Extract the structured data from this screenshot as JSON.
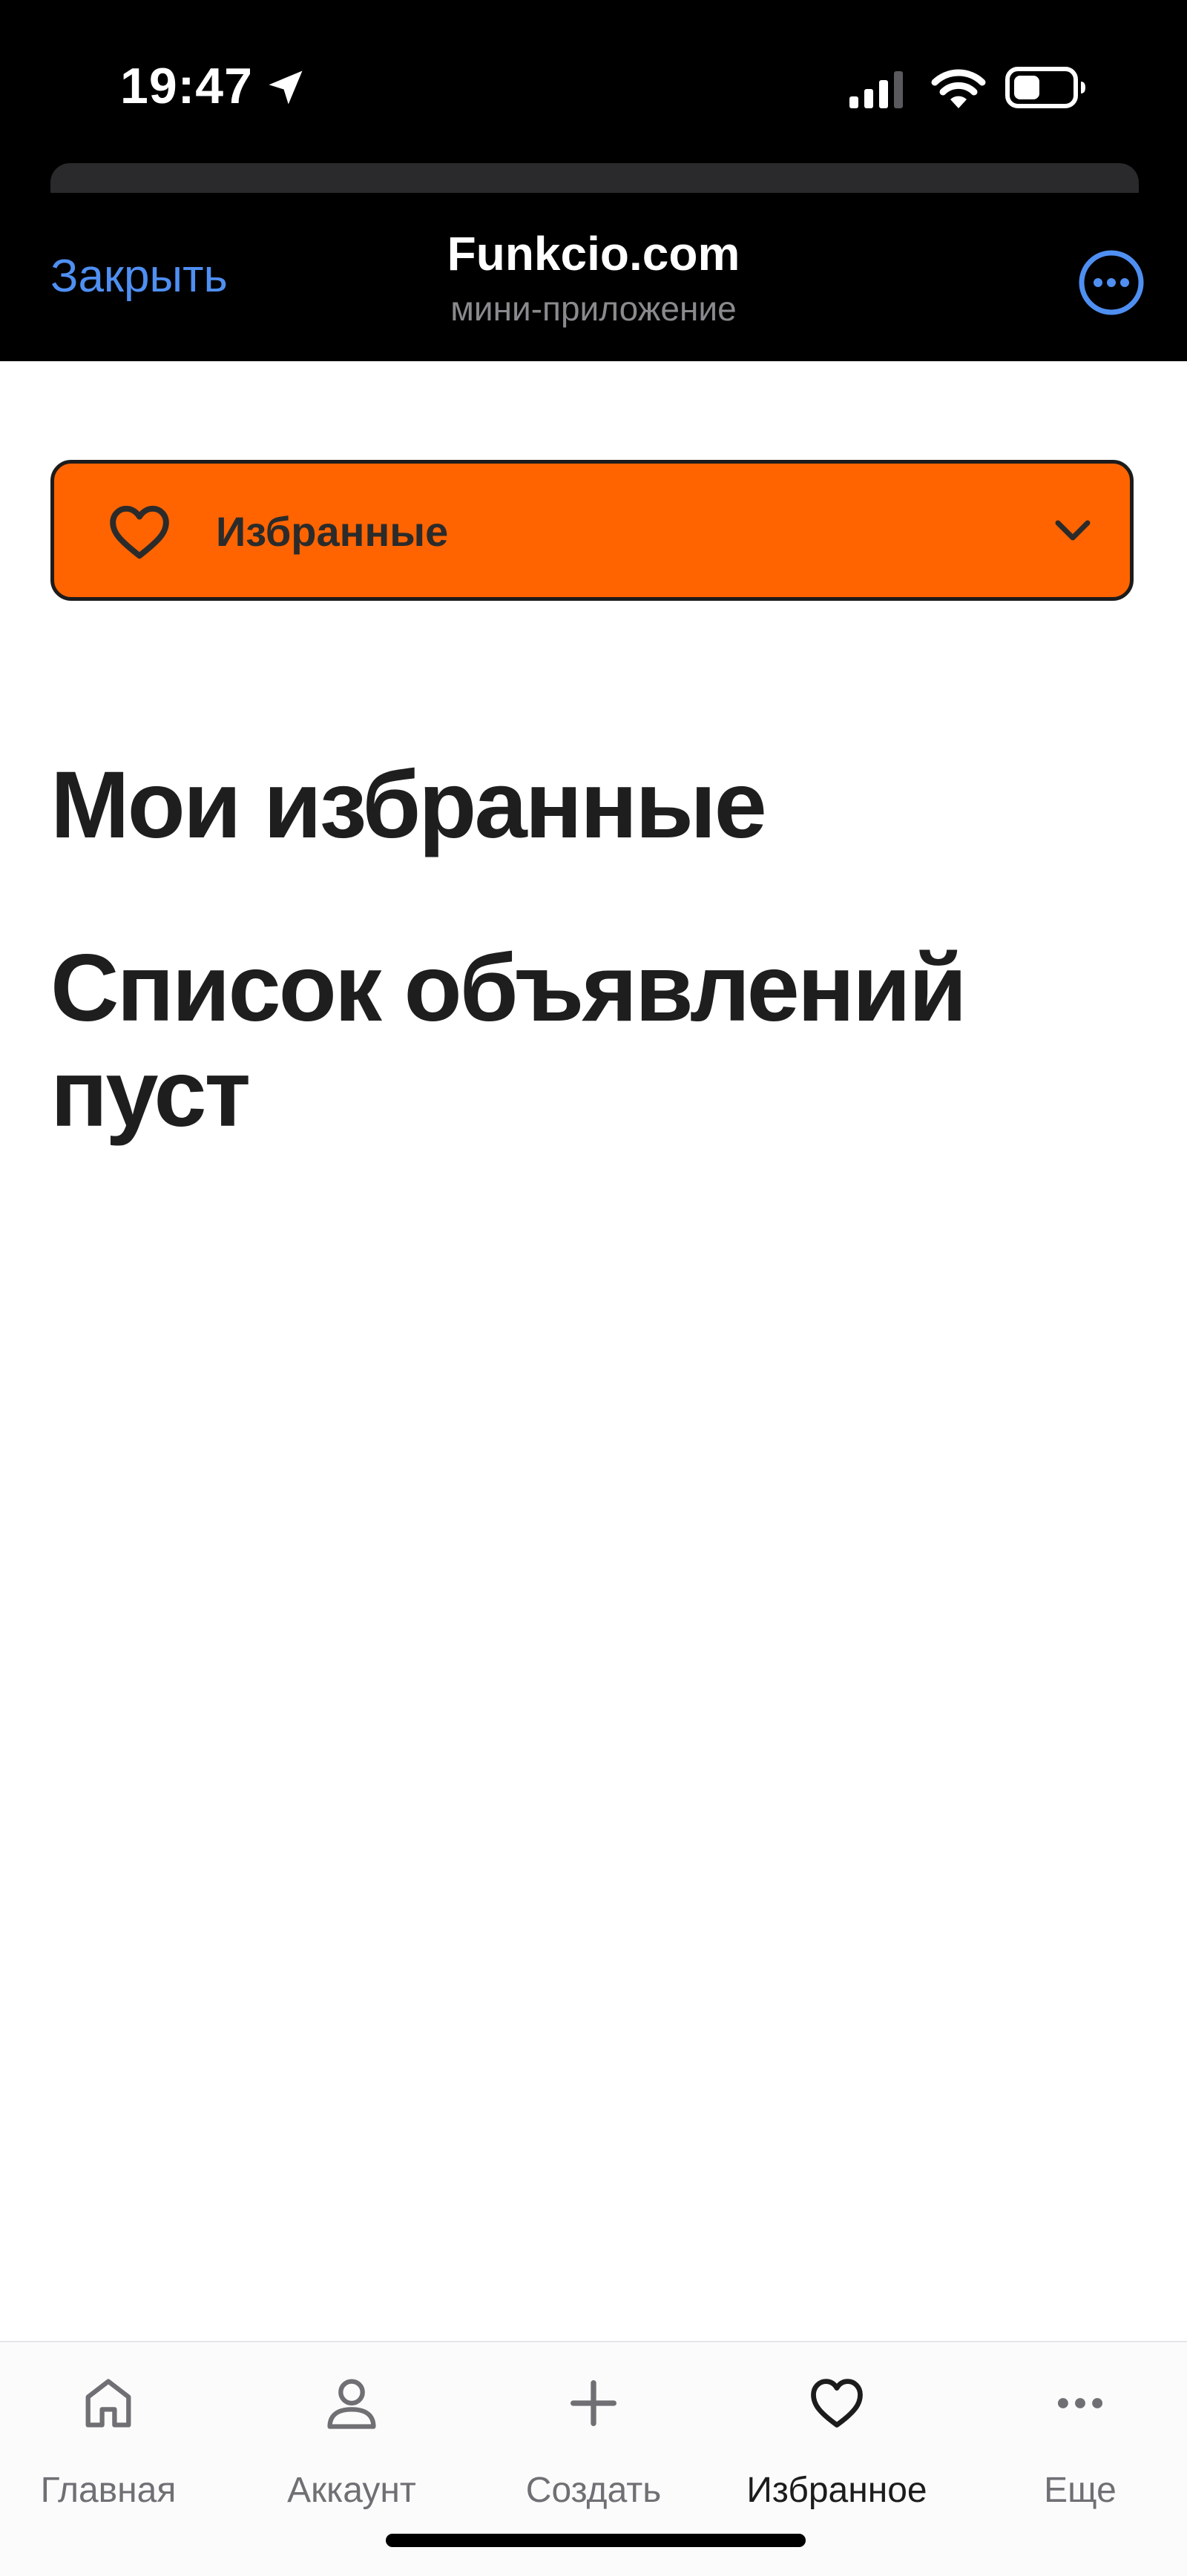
{
  "status_bar": {
    "time": "19:47"
  },
  "header": {
    "close_label": "Закрыть",
    "title": "Funkcio.com",
    "subtitle": "мини-приложение"
  },
  "dropdown": {
    "selected": "Избранные"
  },
  "main": {
    "title": "Мои избранные",
    "empty_message": "Список объявлений пуст"
  },
  "tabs": [
    {
      "label": "Главная",
      "icon": "home-icon"
    },
    {
      "label": "Аккаунт",
      "icon": "user-icon"
    },
    {
      "label": "Создать",
      "icon": "plus-icon"
    },
    {
      "label": "Избранное",
      "icon": "heart-icon",
      "active": true
    },
    {
      "label": "Еще",
      "icon": "more-dots-icon"
    }
  ],
  "colors": {
    "accent_orange": "#ff6400",
    "link_blue": "#4f8ff2",
    "text_dark": "#1e1e1e",
    "header_bg": "#000000"
  }
}
